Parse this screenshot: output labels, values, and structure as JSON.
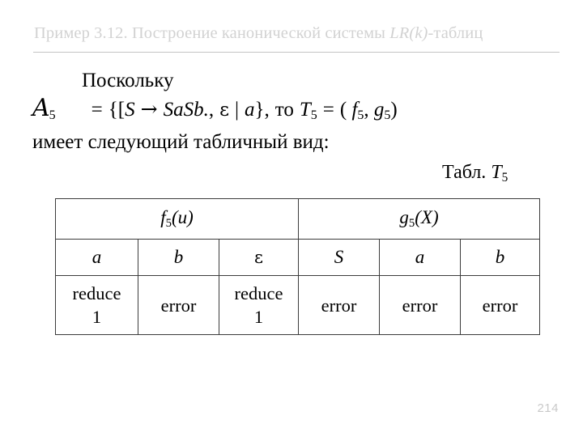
{
  "slide": {
    "title_parts": {
      "before": "Пример 3.12. Построение канонической системы ",
      "italic": "LR(k)",
      "after": "-таблиц"
    },
    "title_plain": "Пример 3.12. Построение канонической системы LR(k)-таблиц",
    "title_color": "#d2d2d2",
    "rule_color": "#c3c3c3",
    "page_number": "214",
    "page_number_color": "#c9c9c9"
  },
  "body": {
    "line1": "Поскольку",
    "formula": {
      "lhs_symbol": "A",
      "lhs_subscript": "5",
      "equals": "=",
      "set_open": "{[",
      "nonterminal": "S",
      "arrow": "→",
      "production": "SaSb.",
      "comma": ",",
      "epsilon": "ε",
      "bar": "|",
      "lookahead": "a",
      "set_close": "}",
      "tail_comma": ",",
      "to_word": "то",
      "result_symbol": "T",
      "result_subscript": "5",
      "equals2": "=",
      "pair_open": "( ",
      "f_symbol": "f",
      "f_subscript": "5",
      "pair_comma": ", ",
      "g_symbol": "g",
      "g_subscript": "5",
      "pair_close": ")",
      "plain": "A5 = {[S → SaSb., ε | a}, то T5 = ( f5, g5)"
    },
    "line3": "имеет следующий табличный вид:",
    "table_caption": {
      "label": "Табл. ",
      "symbol": "T",
      "subscript": "5",
      "plain": "Табл. T5"
    }
  },
  "table": {
    "group_headers": [
      {
        "symbol": "f",
        "subscript": "5",
        "arg": "(u)",
        "plain": "f5(u)",
        "span": 3
      },
      {
        "symbol": "g",
        "subscript": "5",
        "arg": "(X)",
        "plain": "g5(X)",
        "span": 3
      }
    ],
    "symbol_row": [
      "a",
      "b",
      "ε",
      "S",
      "a",
      "b"
    ],
    "action_row": [
      {
        "line1": "reduce",
        "line2": "1",
        "plain": "reduce 1"
      },
      {
        "line1": "error",
        "line2": "",
        "plain": "error"
      },
      {
        "line1": "reduce",
        "line2": "1",
        "plain": "reduce 1"
      },
      {
        "line1": "error",
        "line2": "",
        "plain": "error"
      },
      {
        "line1": "error",
        "line2": "",
        "plain": "error"
      },
      {
        "line1": "error",
        "line2": "",
        "plain": "error"
      }
    ],
    "border_color": "#3c3c3c"
  }
}
